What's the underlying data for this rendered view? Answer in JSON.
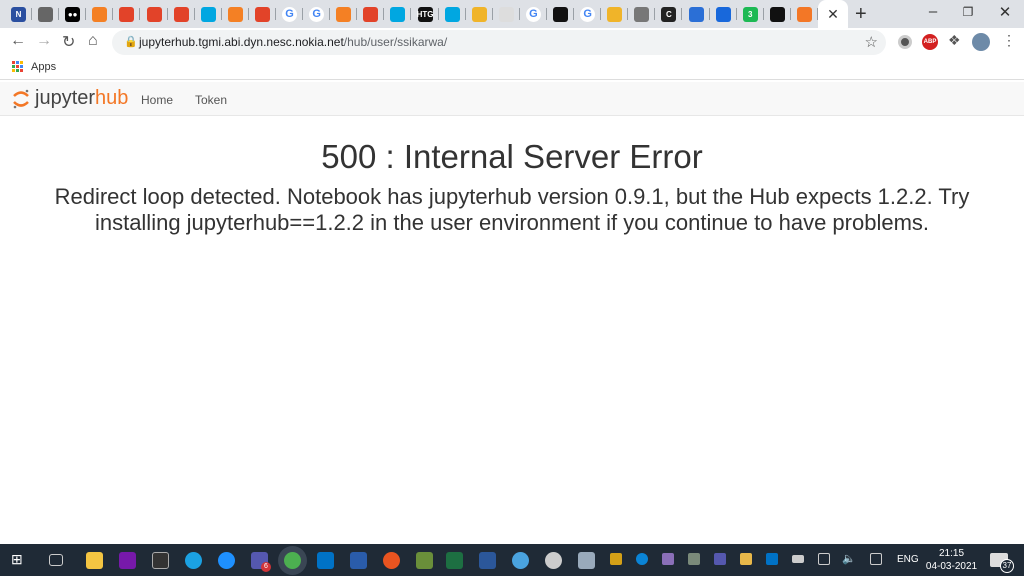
{
  "browser": {
    "tabs": [
      {
        "icon": "notion-icon",
        "c": "#2a4fa0",
        "t": "N"
      },
      {
        "icon": "globe-icon",
        "c": "#666",
        "t": ""
      },
      {
        "icon": "medium-icon",
        "c": "#000",
        "t": "●●"
      },
      {
        "icon": "stackoverflow-icon",
        "c": "#f48024",
        "t": ""
      },
      {
        "icon": "gitlab-icon",
        "c": "#e24329",
        "t": ""
      },
      {
        "icon": "gitlab-icon",
        "c": "#e24329",
        "t": ""
      },
      {
        "icon": "gitlab-icon",
        "c": "#e24329",
        "t": ""
      },
      {
        "icon": "airflow-icon",
        "c": "#00a7e1",
        "t": ""
      },
      {
        "icon": "stackoverflow-icon",
        "c": "#f48024",
        "t": ""
      },
      {
        "icon": "gitlab-icon",
        "c": "#e24329",
        "t": ""
      },
      {
        "icon": "google-icon",
        "c": "#4285f4",
        "t": "G"
      },
      {
        "icon": "google-icon",
        "c": "#4285f4",
        "t": "G"
      },
      {
        "icon": "stackoverflow-icon",
        "c": "#f48024",
        "t": ""
      },
      {
        "icon": "gitlab-icon",
        "c": "#e24329",
        "t": ""
      },
      {
        "icon": "airflow-icon",
        "c": "#00a7e1",
        "t": ""
      },
      {
        "icon": "htg-icon",
        "c": "#111",
        "t": "HTG"
      },
      {
        "icon": "airflow-icon",
        "c": "#00a7e1",
        "t": ""
      },
      {
        "icon": "kibana-icon",
        "c": "#f0b429",
        "t": ""
      },
      {
        "icon": "document-icon",
        "c": "#ddd",
        "t": ""
      },
      {
        "icon": "google-icon",
        "c": "#4285f4",
        "t": "G"
      },
      {
        "icon": "github-icon",
        "c": "#111",
        "t": ""
      },
      {
        "icon": "google-icon",
        "c": "#4285f4",
        "t": "G"
      },
      {
        "icon": "kibana-icon",
        "c": "#f0b429",
        "t": ""
      },
      {
        "icon": "globe-icon",
        "c": "#777",
        "t": ""
      },
      {
        "icon": "codecov-icon",
        "c": "#222",
        "t": "C"
      },
      {
        "icon": "teams-icon",
        "c": "#2b6fd6",
        "t": ""
      },
      {
        "icon": "confluence-icon",
        "c": "#1868db",
        "t": ""
      },
      {
        "icon": "badge-icon",
        "c": "#1db954",
        "t": "3"
      },
      {
        "icon": "github-icon",
        "c": "#111",
        "t": ""
      },
      {
        "icon": "jupyter-icon",
        "c": "#f37726",
        "t": ""
      }
    ],
    "active_tab_close": "✕",
    "new_tab": "+",
    "url_host": "jupyterhub.tgmi.abi.dyn.nesc.nokia.net",
    "url_path": "/hub/user/ssikarwa/",
    "bookmarks_apps": "Apps"
  },
  "jupyterhub": {
    "logo_jupyter": "jupyter",
    "logo_hub": "hub",
    "nav": [
      "Home",
      "Token"
    ],
    "brand_color": "#f37726"
  },
  "error": {
    "title": "500 : Internal Server Error",
    "message": "Redirect loop detected. Notebook has jupyterhub version 0.9.1, but the Hub expects 1.2.2. Try installing jupyterhub==1.2.2 in the user environment if you continue to have problems."
  },
  "taskbar": {
    "lang": "ENG",
    "time": "21:15",
    "date": "04-03-2021",
    "notifications": "37",
    "teams_badge": "6"
  }
}
